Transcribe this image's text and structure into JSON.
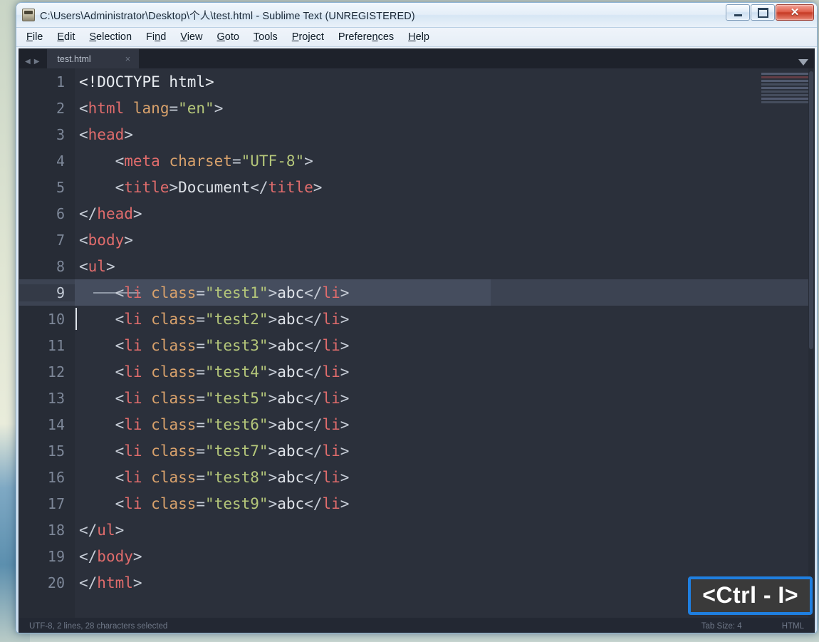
{
  "window": {
    "title": "C:\\Users\\Administrator\\Desktop\\个人\\test.html - Sublime Text (UNREGISTERED)",
    "app_icon": "sublime-icon",
    "controls": {
      "minimize": "–",
      "maximize": "▢",
      "close": "✕"
    }
  },
  "menubar": {
    "items": [
      {
        "label": "File",
        "accel": "F"
      },
      {
        "label": "Edit",
        "accel": "E"
      },
      {
        "label": "Selection",
        "accel": "S"
      },
      {
        "label": "Find",
        "accel": "n"
      },
      {
        "label": "View",
        "accel": "V"
      },
      {
        "label": "Goto",
        "accel": "G"
      },
      {
        "label": "Tools",
        "accel": "T"
      },
      {
        "label": "Project",
        "accel": "P"
      },
      {
        "label": "Preferences",
        "accel": "n"
      },
      {
        "label": "Help",
        "accel": "H"
      }
    ]
  },
  "tabbar": {
    "prev_arrow": "◀",
    "next_arrow": "▶",
    "tabs": [
      {
        "label": "test.html",
        "close": "×",
        "active": true
      }
    ],
    "dropdown": "chevron-down-icon"
  },
  "editor": {
    "syntax": "HTML",
    "tab_size_label": "Tab Size: 4",
    "selection_line": 9,
    "caret_line": 10,
    "lines": [
      {
        "n": "1",
        "tokens": [
          {
            "t": "doctype",
            "v": "<!DOCTYPE html>"
          }
        ]
      },
      {
        "n": "2",
        "tokens": [
          {
            "t": "punct",
            "v": "<"
          },
          {
            "t": "tagnm",
            "v": "html"
          },
          {
            "t": "punct",
            "v": " "
          },
          {
            "t": "attr",
            "v": "lang"
          },
          {
            "t": "eq",
            "v": "="
          },
          {
            "t": "str",
            "v": "\"en\""
          },
          {
            "t": "punct",
            "v": ">"
          }
        ]
      },
      {
        "n": "3",
        "tokens": [
          {
            "t": "punct",
            "v": "<"
          },
          {
            "t": "tagnm",
            "v": "head"
          },
          {
            "t": "punct",
            "v": ">"
          }
        ]
      },
      {
        "n": "4",
        "tokens": [
          {
            "t": "punct",
            "v": "    <"
          },
          {
            "t": "tagnm",
            "v": "meta"
          },
          {
            "t": "punct",
            "v": " "
          },
          {
            "t": "attr",
            "v": "charset"
          },
          {
            "t": "eq",
            "v": "="
          },
          {
            "t": "str",
            "v": "\"UTF-8\""
          },
          {
            "t": "punct",
            "v": ">"
          }
        ]
      },
      {
        "n": "5",
        "tokens": [
          {
            "t": "punct",
            "v": "    <"
          },
          {
            "t": "tagnm",
            "v": "title"
          },
          {
            "t": "punct",
            "v": ">"
          },
          {
            "t": "txt",
            "v": "Document"
          },
          {
            "t": "punct",
            "v": "</"
          },
          {
            "t": "tagnm",
            "v": "title"
          },
          {
            "t": "punct",
            "v": ">"
          }
        ]
      },
      {
        "n": "6",
        "tokens": [
          {
            "t": "punct",
            "v": "</"
          },
          {
            "t": "tagnm",
            "v": "head"
          },
          {
            "t": "punct",
            "v": ">"
          }
        ]
      },
      {
        "n": "7",
        "tokens": [
          {
            "t": "punct",
            "v": "<"
          },
          {
            "t": "tagnm",
            "v": "body"
          },
          {
            "t": "punct",
            "v": ">"
          }
        ]
      },
      {
        "n": "8",
        "tokens": [
          {
            "t": "punct",
            "v": "<"
          },
          {
            "t": "tagnm",
            "v": "ul"
          },
          {
            "t": "punct",
            "v": ">"
          }
        ]
      },
      {
        "n": "9",
        "tokens": [
          {
            "t": "punct",
            "v": "    <"
          },
          {
            "t": "tagnm",
            "v": "li"
          },
          {
            "t": "punct",
            "v": " "
          },
          {
            "t": "attr",
            "v": "class"
          },
          {
            "t": "eq",
            "v": "="
          },
          {
            "t": "str",
            "v": "\"test1\""
          },
          {
            "t": "punct",
            "v": ">"
          },
          {
            "t": "txt",
            "v": "abc"
          },
          {
            "t": "punct",
            "v": "</"
          },
          {
            "t": "tagnm",
            "v": "li"
          },
          {
            "t": "punct",
            "v": ">"
          }
        ]
      },
      {
        "n": "10",
        "tokens": [
          {
            "t": "punct",
            "v": "    <"
          },
          {
            "t": "tagnm",
            "v": "li"
          },
          {
            "t": "punct",
            "v": " "
          },
          {
            "t": "attr",
            "v": "class"
          },
          {
            "t": "eq",
            "v": "="
          },
          {
            "t": "str",
            "v": "\"test2\""
          },
          {
            "t": "punct",
            "v": ">"
          },
          {
            "t": "txt",
            "v": "abc"
          },
          {
            "t": "punct",
            "v": "</"
          },
          {
            "t": "tagnm",
            "v": "li"
          },
          {
            "t": "punct",
            "v": ">"
          }
        ]
      },
      {
        "n": "11",
        "tokens": [
          {
            "t": "punct",
            "v": "    <"
          },
          {
            "t": "tagnm",
            "v": "li"
          },
          {
            "t": "punct",
            "v": " "
          },
          {
            "t": "attr",
            "v": "class"
          },
          {
            "t": "eq",
            "v": "="
          },
          {
            "t": "str",
            "v": "\"test3\""
          },
          {
            "t": "punct",
            "v": ">"
          },
          {
            "t": "txt",
            "v": "abc"
          },
          {
            "t": "punct",
            "v": "</"
          },
          {
            "t": "tagnm",
            "v": "li"
          },
          {
            "t": "punct",
            "v": ">"
          }
        ]
      },
      {
        "n": "12",
        "tokens": [
          {
            "t": "punct",
            "v": "    <"
          },
          {
            "t": "tagnm",
            "v": "li"
          },
          {
            "t": "punct",
            "v": " "
          },
          {
            "t": "attr",
            "v": "class"
          },
          {
            "t": "eq",
            "v": "="
          },
          {
            "t": "str",
            "v": "\"test4\""
          },
          {
            "t": "punct",
            "v": ">"
          },
          {
            "t": "txt",
            "v": "abc"
          },
          {
            "t": "punct",
            "v": "</"
          },
          {
            "t": "tagnm",
            "v": "li"
          },
          {
            "t": "punct",
            "v": ">"
          }
        ]
      },
      {
        "n": "13",
        "tokens": [
          {
            "t": "punct",
            "v": "    <"
          },
          {
            "t": "tagnm",
            "v": "li"
          },
          {
            "t": "punct",
            "v": " "
          },
          {
            "t": "attr",
            "v": "class"
          },
          {
            "t": "eq",
            "v": "="
          },
          {
            "t": "str",
            "v": "\"test5\""
          },
          {
            "t": "punct",
            "v": ">"
          },
          {
            "t": "txt",
            "v": "abc"
          },
          {
            "t": "punct",
            "v": "</"
          },
          {
            "t": "tagnm",
            "v": "li"
          },
          {
            "t": "punct",
            "v": ">"
          }
        ]
      },
      {
        "n": "14",
        "tokens": [
          {
            "t": "punct",
            "v": "    <"
          },
          {
            "t": "tagnm",
            "v": "li"
          },
          {
            "t": "punct",
            "v": " "
          },
          {
            "t": "attr",
            "v": "class"
          },
          {
            "t": "eq",
            "v": "="
          },
          {
            "t": "str",
            "v": "\"test6\""
          },
          {
            "t": "punct",
            "v": ">"
          },
          {
            "t": "txt",
            "v": "abc"
          },
          {
            "t": "punct",
            "v": "</"
          },
          {
            "t": "tagnm",
            "v": "li"
          },
          {
            "t": "punct",
            "v": ">"
          }
        ]
      },
      {
        "n": "15",
        "tokens": [
          {
            "t": "punct",
            "v": "    <"
          },
          {
            "t": "tagnm",
            "v": "li"
          },
          {
            "t": "punct",
            "v": " "
          },
          {
            "t": "attr",
            "v": "class"
          },
          {
            "t": "eq",
            "v": "="
          },
          {
            "t": "str",
            "v": "\"test7\""
          },
          {
            "t": "punct",
            "v": ">"
          },
          {
            "t": "txt",
            "v": "abc"
          },
          {
            "t": "punct",
            "v": "</"
          },
          {
            "t": "tagnm",
            "v": "li"
          },
          {
            "t": "punct",
            "v": ">"
          }
        ]
      },
      {
        "n": "16",
        "tokens": [
          {
            "t": "punct",
            "v": "    <"
          },
          {
            "t": "tagnm",
            "v": "li"
          },
          {
            "t": "punct",
            "v": " "
          },
          {
            "t": "attr",
            "v": "class"
          },
          {
            "t": "eq",
            "v": "="
          },
          {
            "t": "str",
            "v": "\"test8\""
          },
          {
            "t": "punct",
            "v": ">"
          },
          {
            "t": "txt",
            "v": "abc"
          },
          {
            "t": "punct",
            "v": "</"
          },
          {
            "t": "tagnm",
            "v": "li"
          },
          {
            "t": "punct",
            "v": ">"
          }
        ]
      },
      {
        "n": "17",
        "tokens": [
          {
            "t": "punct",
            "v": "    <"
          },
          {
            "t": "tagnm",
            "v": "li"
          },
          {
            "t": "punct",
            "v": " "
          },
          {
            "t": "attr",
            "v": "class"
          },
          {
            "t": "eq",
            "v": "="
          },
          {
            "t": "str",
            "v": "\"test9\""
          },
          {
            "t": "punct",
            "v": ">"
          },
          {
            "t": "txt",
            "v": "abc"
          },
          {
            "t": "punct",
            "v": "</"
          },
          {
            "t": "tagnm",
            "v": "li"
          },
          {
            "t": "punct",
            "v": ">"
          }
        ]
      },
      {
        "n": "18",
        "tokens": [
          {
            "t": "punct",
            "v": "</"
          },
          {
            "t": "tagnm",
            "v": "ul"
          },
          {
            "t": "punct",
            "v": ">"
          }
        ]
      },
      {
        "n": "19",
        "tokens": [
          {
            "t": "punct",
            "v": "</"
          },
          {
            "t": "tagnm",
            "v": "body"
          },
          {
            "t": "punct",
            "v": ">"
          }
        ]
      },
      {
        "n": "20",
        "tokens": [
          {
            "t": "punct",
            "v": "</"
          },
          {
            "t": "tagnm",
            "v": "html"
          },
          {
            "t": "punct",
            "v": ">"
          }
        ]
      }
    ]
  },
  "statusbar": {
    "left": "UTF-8, 2 lines, 28 characters selected",
    "tab_size": "Tab Size: 4",
    "syntax": "HTML"
  },
  "overlay": {
    "hotkey_badge": "<Ctrl - I>",
    "badge_border_color": "#1f7fe0",
    "badge_bg_color": "#3a3a3a"
  },
  "colors": {
    "editor_bg": "#2b303b",
    "gutter_bg": "#272c36",
    "tabbar_bg": "#1e222b",
    "tag": "#e06c6c",
    "attribute": "#d9a26c",
    "string": "#b5c77a",
    "text": "#dfe3e9",
    "selection": "#454d5e"
  }
}
